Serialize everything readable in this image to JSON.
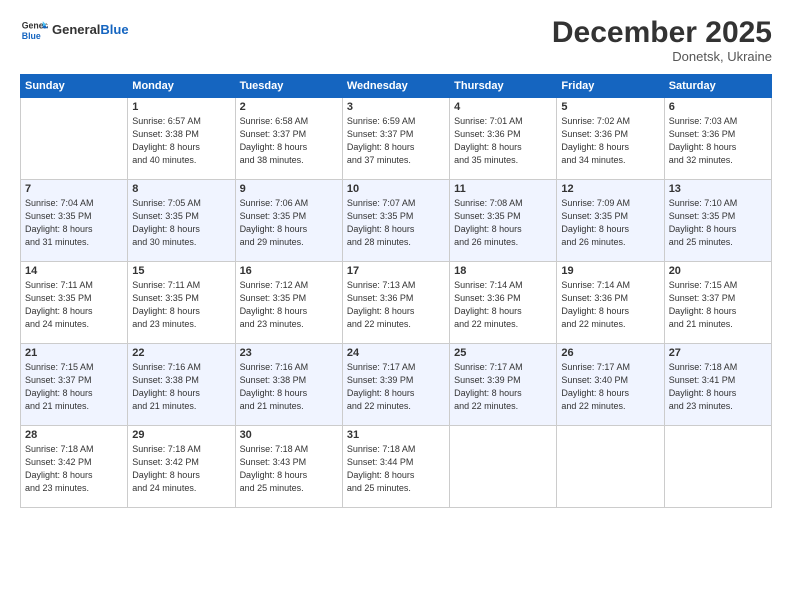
{
  "header": {
    "logo_general": "General",
    "logo_blue": "Blue",
    "month": "December 2025",
    "location": "Donetsk, Ukraine"
  },
  "weekdays": [
    "Sunday",
    "Monday",
    "Tuesday",
    "Wednesday",
    "Thursday",
    "Friday",
    "Saturday"
  ],
  "weeks": [
    [
      {
        "day": "",
        "info": ""
      },
      {
        "day": "1",
        "info": "Sunrise: 6:57 AM\nSunset: 3:38 PM\nDaylight: 8 hours\nand 40 minutes."
      },
      {
        "day": "2",
        "info": "Sunrise: 6:58 AM\nSunset: 3:37 PM\nDaylight: 8 hours\nand 38 minutes."
      },
      {
        "day": "3",
        "info": "Sunrise: 6:59 AM\nSunset: 3:37 PM\nDaylight: 8 hours\nand 37 minutes."
      },
      {
        "day": "4",
        "info": "Sunrise: 7:01 AM\nSunset: 3:36 PM\nDaylight: 8 hours\nand 35 minutes."
      },
      {
        "day": "5",
        "info": "Sunrise: 7:02 AM\nSunset: 3:36 PM\nDaylight: 8 hours\nand 34 minutes."
      },
      {
        "day": "6",
        "info": "Sunrise: 7:03 AM\nSunset: 3:36 PM\nDaylight: 8 hours\nand 32 minutes."
      }
    ],
    [
      {
        "day": "7",
        "info": "Sunrise: 7:04 AM\nSunset: 3:35 PM\nDaylight: 8 hours\nand 31 minutes."
      },
      {
        "day": "8",
        "info": "Sunrise: 7:05 AM\nSunset: 3:35 PM\nDaylight: 8 hours\nand 30 minutes."
      },
      {
        "day": "9",
        "info": "Sunrise: 7:06 AM\nSunset: 3:35 PM\nDaylight: 8 hours\nand 29 minutes."
      },
      {
        "day": "10",
        "info": "Sunrise: 7:07 AM\nSunset: 3:35 PM\nDaylight: 8 hours\nand 28 minutes."
      },
      {
        "day": "11",
        "info": "Sunrise: 7:08 AM\nSunset: 3:35 PM\nDaylight: 8 hours\nand 26 minutes."
      },
      {
        "day": "12",
        "info": "Sunrise: 7:09 AM\nSunset: 3:35 PM\nDaylight: 8 hours\nand 26 minutes."
      },
      {
        "day": "13",
        "info": "Sunrise: 7:10 AM\nSunset: 3:35 PM\nDaylight: 8 hours\nand 25 minutes."
      }
    ],
    [
      {
        "day": "14",
        "info": "Sunrise: 7:11 AM\nSunset: 3:35 PM\nDaylight: 8 hours\nand 24 minutes."
      },
      {
        "day": "15",
        "info": "Sunrise: 7:11 AM\nSunset: 3:35 PM\nDaylight: 8 hours\nand 23 minutes."
      },
      {
        "day": "16",
        "info": "Sunrise: 7:12 AM\nSunset: 3:35 PM\nDaylight: 8 hours\nand 23 minutes."
      },
      {
        "day": "17",
        "info": "Sunrise: 7:13 AM\nSunset: 3:36 PM\nDaylight: 8 hours\nand 22 minutes."
      },
      {
        "day": "18",
        "info": "Sunrise: 7:14 AM\nSunset: 3:36 PM\nDaylight: 8 hours\nand 22 minutes."
      },
      {
        "day": "19",
        "info": "Sunrise: 7:14 AM\nSunset: 3:36 PM\nDaylight: 8 hours\nand 22 minutes."
      },
      {
        "day": "20",
        "info": "Sunrise: 7:15 AM\nSunset: 3:37 PM\nDaylight: 8 hours\nand 21 minutes."
      }
    ],
    [
      {
        "day": "21",
        "info": "Sunrise: 7:15 AM\nSunset: 3:37 PM\nDaylight: 8 hours\nand 21 minutes."
      },
      {
        "day": "22",
        "info": "Sunrise: 7:16 AM\nSunset: 3:38 PM\nDaylight: 8 hours\nand 21 minutes."
      },
      {
        "day": "23",
        "info": "Sunrise: 7:16 AM\nSunset: 3:38 PM\nDaylight: 8 hours\nand 21 minutes."
      },
      {
        "day": "24",
        "info": "Sunrise: 7:17 AM\nSunset: 3:39 PM\nDaylight: 8 hours\nand 22 minutes."
      },
      {
        "day": "25",
        "info": "Sunrise: 7:17 AM\nSunset: 3:39 PM\nDaylight: 8 hours\nand 22 minutes."
      },
      {
        "day": "26",
        "info": "Sunrise: 7:17 AM\nSunset: 3:40 PM\nDaylight: 8 hours\nand 22 minutes."
      },
      {
        "day": "27",
        "info": "Sunrise: 7:18 AM\nSunset: 3:41 PM\nDaylight: 8 hours\nand 23 minutes."
      }
    ],
    [
      {
        "day": "28",
        "info": "Sunrise: 7:18 AM\nSunset: 3:42 PM\nDaylight: 8 hours\nand 23 minutes."
      },
      {
        "day": "29",
        "info": "Sunrise: 7:18 AM\nSunset: 3:42 PM\nDaylight: 8 hours\nand 24 minutes."
      },
      {
        "day": "30",
        "info": "Sunrise: 7:18 AM\nSunset: 3:43 PM\nDaylight: 8 hours\nand 25 minutes."
      },
      {
        "day": "31",
        "info": "Sunrise: 7:18 AM\nSunset: 3:44 PM\nDaylight: 8 hours\nand 25 minutes."
      },
      {
        "day": "",
        "info": ""
      },
      {
        "day": "",
        "info": ""
      },
      {
        "day": "",
        "info": ""
      }
    ]
  ]
}
